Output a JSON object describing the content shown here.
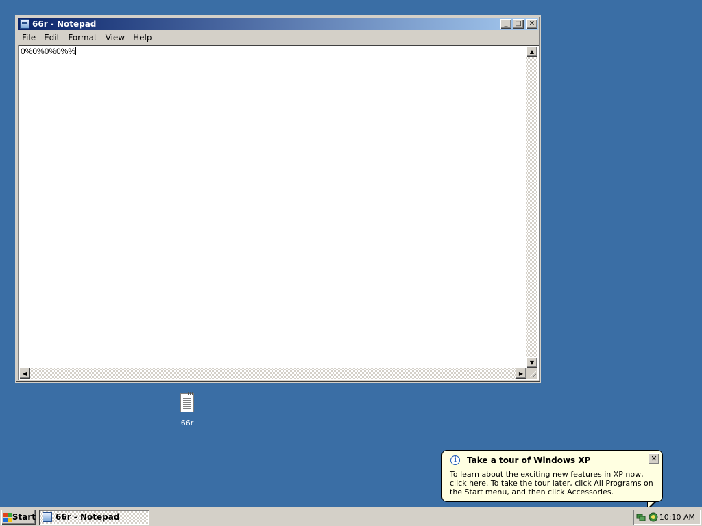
{
  "window": {
    "title": "66r - Notepad",
    "controls": {
      "minimize": "_",
      "maximize": "□",
      "close": "✕"
    },
    "menu": [
      "File",
      "Edit",
      "Format",
      "View",
      "Help"
    ],
    "content": "0%0%0%0%%"
  },
  "scrollbar": {
    "up": "▲",
    "down": "▼",
    "left": "◀",
    "right": "▶"
  },
  "desktop": {
    "icons": [
      {
        "label": "66r",
        "icon": "text-document-icon"
      }
    ]
  },
  "balloon": {
    "title": "Take a tour of Windows XP",
    "body": "To learn about the exciting new features in XP now, click here. To take the tour later, click All Programs on the Start menu, and then click Accessories.",
    "close": "✕",
    "info_glyph": "i"
  },
  "taskbar": {
    "start_label": "Start",
    "tasks": [
      {
        "label": "66r - Notepad"
      }
    ],
    "clock": "10:10 AM",
    "tray_icons": [
      "network-icon",
      "tour-icon"
    ]
  },
  "colors": {
    "desktop": "#3a6ea5",
    "titlebar_start": "#0a246a",
    "titlebar_end": "#a6caf0",
    "face": "#d4d0c8",
    "balloon_bg": "#ffffe1"
  }
}
